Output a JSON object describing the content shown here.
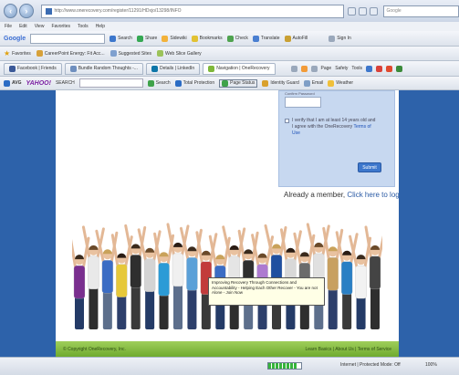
{
  "browser": {
    "url": "http://www.onerecovery.com/register/11291/HDxjo/13298/INFO",
    "search_placeholder": "Google",
    "menu": [
      "File",
      "Edit",
      "View",
      "Favorites",
      "Tools",
      "Help"
    ]
  },
  "google_toolbar": {
    "logo": "Google",
    "items": [
      "Search",
      "Share",
      "Sidewiki",
      "Bookmarks",
      "Check",
      "Translate",
      "AutoFill",
      "Sign In"
    ]
  },
  "favorites_bar": {
    "label": "Favorites",
    "items": [
      "CareerPoint Energy: Fit Acc...",
      "Suggested Sites",
      "Web Slice Gallery"
    ]
  },
  "tabs": [
    "Facebook | Friends",
    "Bundle Random Thoughts -...",
    "Details | LinkedIn",
    "Navigation | OneRecovery"
  ],
  "command_bar": [
    "Page",
    "Safety",
    "Tools"
  ],
  "avg_toolbar": {
    "brand": "AVG",
    "yahoo": "YAHOO!",
    "search_label": "SEARCH",
    "search_button": "Search",
    "items": [
      "Total Protection",
      "Page Status",
      "Identity Guard",
      "Email",
      "Weather"
    ]
  },
  "signup": {
    "field_label": "Confirm Password",
    "agree_text": "I verify that I am at least 14 years old and I agree with the OneRecovery",
    "terms_link": "Terms of Use",
    "submit": "Submit"
  },
  "member": {
    "prefix": "Already a member,",
    "link": "Click here to login"
  },
  "tooltip": "Improving Recovery Through Connections and Accountability - Helping Each Other Recover - You are not Alone - Join Now",
  "footer": {
    "copyright": "© Copyright OneRecovery, Inc.",
    "links": "Learn Basics | About Us | Terms of Service"
  },
  "status": {
    "zone": "Internet | Protected Mode: Off",
    "zoom": "100%",
    "progress": 0.9
  },
  "colors": {
    "page_background": "#2d62aa",
    "footer_green": "#7fb83a",
    "signup_panel": "#c7d8f0",
    "link_blue": "#2a5aa4"
  }
}
